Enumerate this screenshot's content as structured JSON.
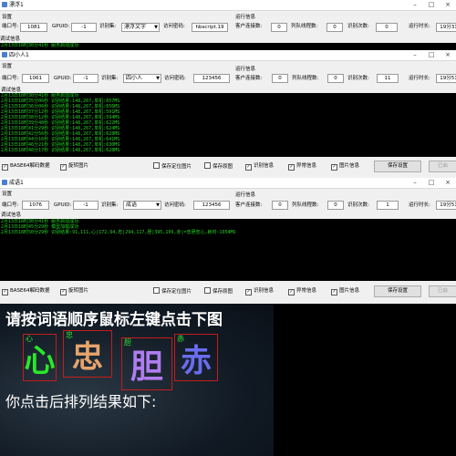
{
  "windows": [
    {
      "title": "漂浮1",
      "settings_label": "设置",
      "port_label": "端口号:",
      "port_value": "1081",
      "gpuid_label": "GPUID:",
      "gpuid_value": "-1",
      "mode_label": "识别集:",
      "mode_value": "漂浮文字",
      "password_label": "访问密码:",
      "password_value": "hbscript.19",
      "run_info_label": "运行信息",
      "clients_label": "客户连接数:",
      "clients_value": "0",
      "queue_label": "列队线程数:",
      "queue_value": "0",
      "recog_count_label": "识别次数:",
      "recog_count_value": "0",
      "run_time_label": "运行时长:",
      "run_time_value": "19分31",
      "debug_label": "调试信息",
      "log": [
        "2月13日18时30分41秒 服务启动成功"
      ]
    },
    {
      "title": "四小人1",
      "settings_label": "设置",
      "port_label": "端口号:",
      "port_value": "1061",
      "gpuid_label": "GPUID:",
      "gpuid_value": "-1",
      "mode_label": "识别集:",
      "mode_value": "四小人",
      "password_label": "访问密码:",
      "password_value": "123456",
      "run_info_label": "运行信息",
      "clients_label": "客户连接数:",
      "clients_value": "0",
      "queue_label": "列队线程数:",
      "queue_value": "0",
      "recog_count_label": "识别次数:",
      "recog_count_value": "11",
      "run_time_label": "运行时长:",
      "run_time_value": "19分51",
      "debug_label": "调试信息",
      "log": [
        "2月13日18时30分41秒 服务启动成功",
        "2月13日18时35分06秒 识别结果:148,267,单机:657MS",
        "2月13日18时36分06秒 识别结果:148,267,单机:656MS",
        "2月13日18时37分12秒 识别结果:148,267,单机:591MS",
        "2月13日18时38分12秒 识别结果:148,267,单机:594MS",
        "2月13日18时39分48秒 识别结果:148,267,单机:622MS",
        "2月13日18时41分29秒 识别结果:148,267,单机:624MS",
        "2月13日18时42分56秒 识别结果:148,267,单机:628MS",
        "2月13日18时44分16秒 识别结果:148,267,单机:641MS",
        "2月13日18时46分21秒 识别结果:148,267,单机:630MS",
        "2月13日18时48分17秒 识别结果:148,267,单机:628MS"
      ],
      "checkboxes": [
        {
          "label": "BASE64解码数据",
          "checked": true
        },
        {
          "label": "旋转图片",
          "checked": true
        },
        {
          "label": "保存定位图片",
          "checked": false
        },
        {
          "label": "保存原图",
          "checked": false
        },
        {
          "label": "识别信息",
          "checked": true
        },
        {
          "label": "异常信息",
          "checked": true
        },
        {
          "label": "图片信息",
          "checked": true
        }
      ],
      "save_button": "保存设置",
      "start_button": "已启"
    },
    {
      "title": "成语1",
      "settings_label": "设置",
      "port_label": "端口号:",
      "port_value": "1076",
      "gpuid_label": "GPUID:",
      "gpuid_value": "-1",
      "mode_label": "识别集:",
      "mode_value": "成语",
      "password_label": "访问密码:",
      "password_value": "123456",
      "run_info_label": "运行信息",
      "clients_label": "客户连接数:",
      "clients_value": "0",
      "queue_label": "列队线程数:",
      "queue_value": "0",
      "recog_count_label": "识别次数:",
      "recog_count_value": "1",
      "run_time_label": "运行时长:",
      "run_time_value": "19分51",
      "debug_label": "调试信息",
      "log": [
        "2月13日18时30分41秒 服务启动成功",
        "2月13日18时45分29秒 模型加载成功",
        "2月13日18时50分29秒 识别结果:91,111,心|172,94,忠|294,117,胆|395,109,赤|=忠胆忠心,耗时:1954MS"
      ],
      "checkboxes": [
        {
          "label": "BASE64解码数据",
          "checked": true
        },
        {
          "label": "旋转图片",
          "checked": true
        },
        {
          "label": "保存定位图片",
          "checked": false
        },
        {
          "label": "保存原图",
          "checked": false
        },
        {
          "label": "识别信息",
          "checked": true
        },
        {
          "label": "异常信息",
          "checked": true
        },
        {
          "label": "图片信息",
          "checked": true
        }
      ],
      "save_button": "保存设置",
      "start_button": "已启"
    }
  ],
  "captcha": {
    "instruction": "请按词语顺序鼠标左键点击下图",
    "result_text": "你点击后排列结果如下:",
    "chars": [
      {
        "num": "心",
        "char": "心",
        "color": "#28e828"
      },
      {
        "num": "忠",
        "char": "忠",
        "color": "#e7a46c"
      },
      {
        "num": "胆",
        "char": "胆",
        "color": "#b07cf0"
      },
      {
        "num": "赤",
        "char": "赤",
        "color": "#6a6cf0"
      }
    ]
  }
}
